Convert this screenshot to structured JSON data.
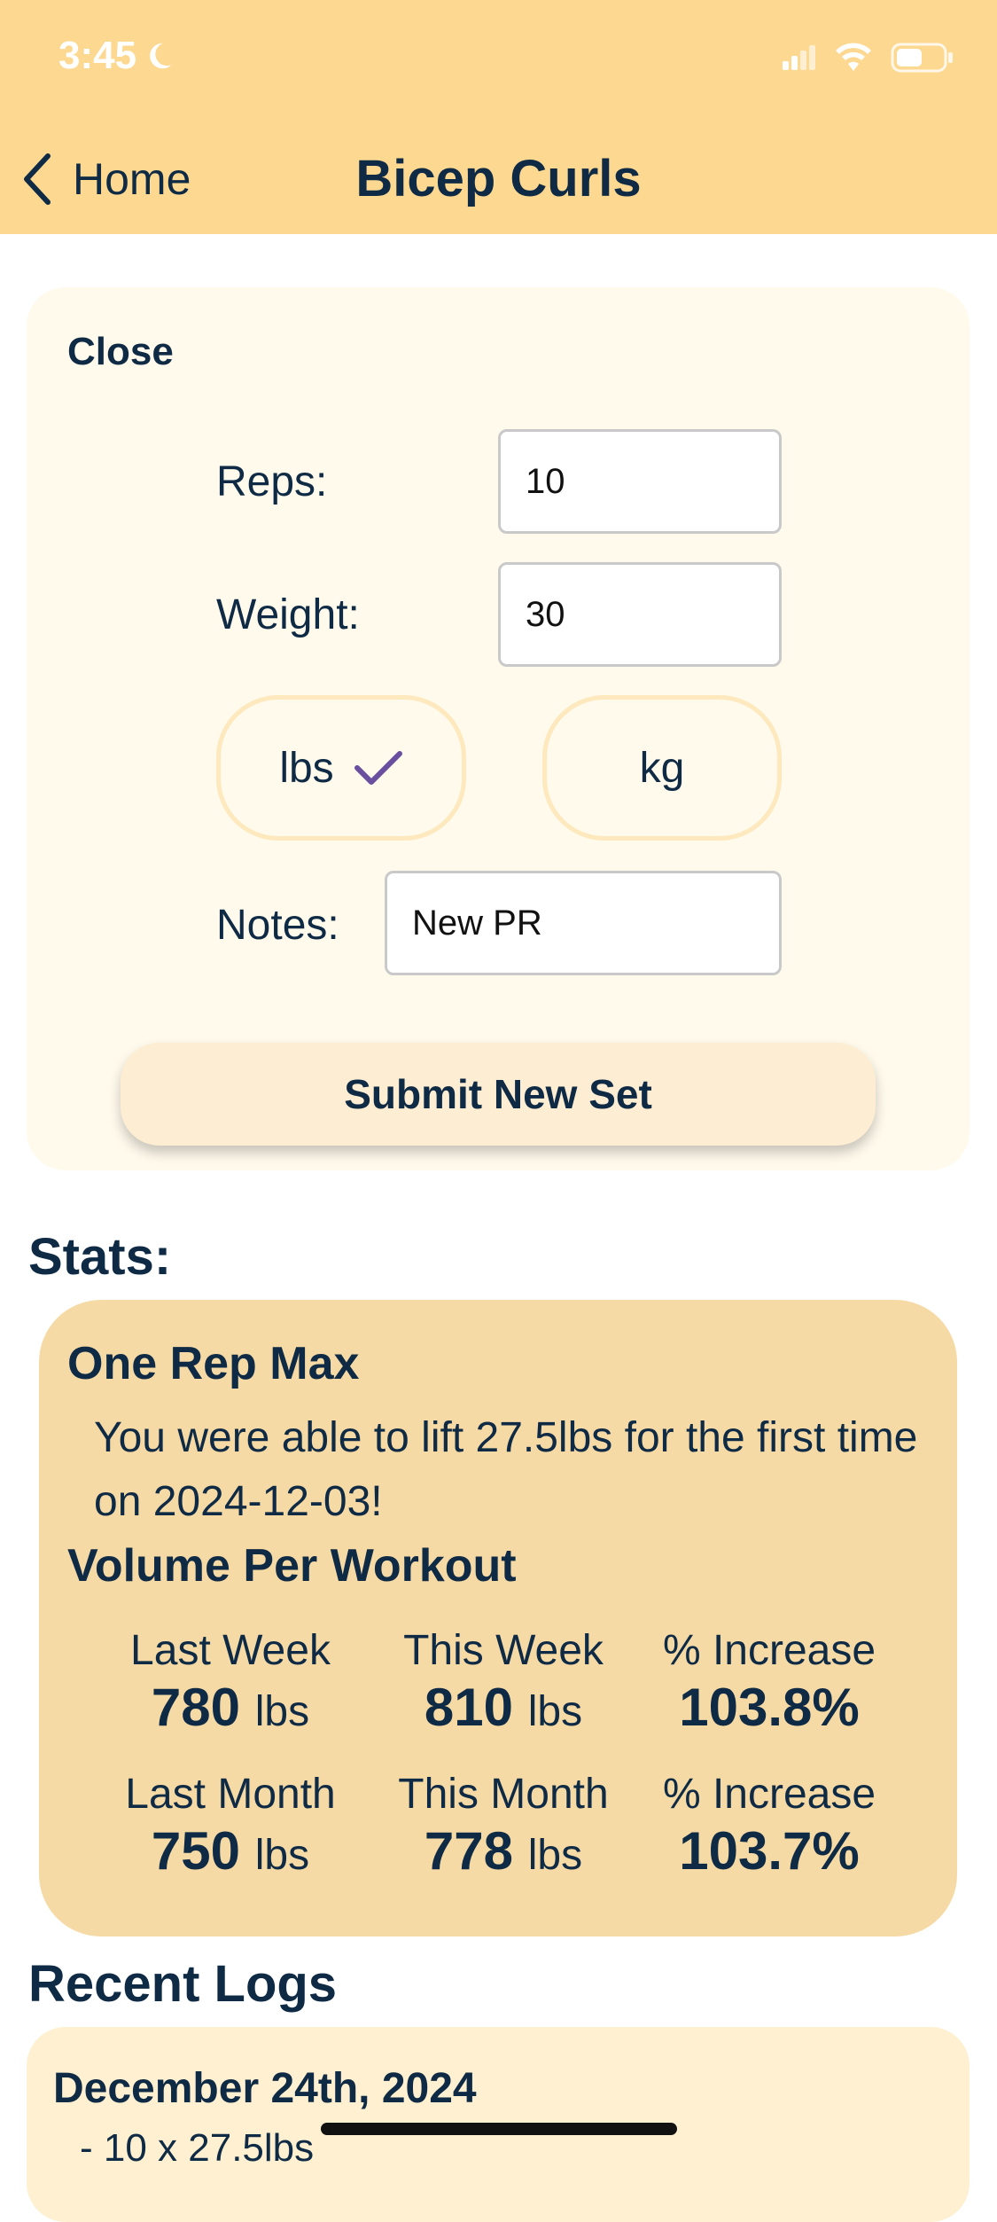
{
  "status_bar": {
    "time": "3:45"
  },
  "nav": {
    "back_label": "Home",
    "title": "Bicep Curls"
  },
  "form": {
    "close_label": "Close",
    "reps_label": "Reps:",
    "reps_value": "10",
    "weight_label": "Weight:",
    "weight_value": "30",
    "unit_lbs": "lbs",
    "unit_kg": "kg",
    "selected_unit": "lbs",
    "notes_label": "Notes:",
    "notes_value": "New PR",
    "submit_label": "Submit New Set"
  },
  "stats": {
    "heading": "Stats:",
    "one_rep_max": {
      "title": "One Rep Max",
      "text": "You were able to lift 27.5lbs for the first time on 2024-12-03!"
    },
    "volume": {
      "title": "Volume Per Workout",
      "rows": [
        {
          "prev_label": "Last Week",
          "prev_value": "780",
          "prev_unit": "lbs",
          "curr_label": "This Week",
          "curr_value": "810",
          "curr_unit": "lbs",
          "inc_label": "% Increase",
          "inc_value": "103.8%"
        },
        {
          "prev_label": "Last Month",
          "prev_value": "750",
          "prev_unit": "lbs",
          "curr_label": "This Month",
          "curr_value": "778",
          "curr_unit": "lbs",
          "inc_label": "% Increase",
          "inc_value": "103.7%"
        }
      ]
    }
  },
  "logs": {
    "heading": "Recent Logs",
    "items": [
      {
        "date": "December 24th, 2024",
        "entry": "- 10 x 27.5lbs"
      }
    ]
  },
  "colors": {
    "header_bg": "#fdd890",
    "form_card_bg": "#fffaec",
    "stats_card_bg": "#f6daa6",
    "log_card_bg": "#fef0d0",
    "text_primary": "#0f2a44",
    "check_accent": "#6a4fa0"
  },
  "icons": {
    "moon": "moon-icon",
    "signal": "cellular-signal-icon",
    "wifi": "wifi-icon",
    "battery": "battery-icon",
    "back": "chevron-left-icon",
    "check": "checkmark-icon"
  }
}
